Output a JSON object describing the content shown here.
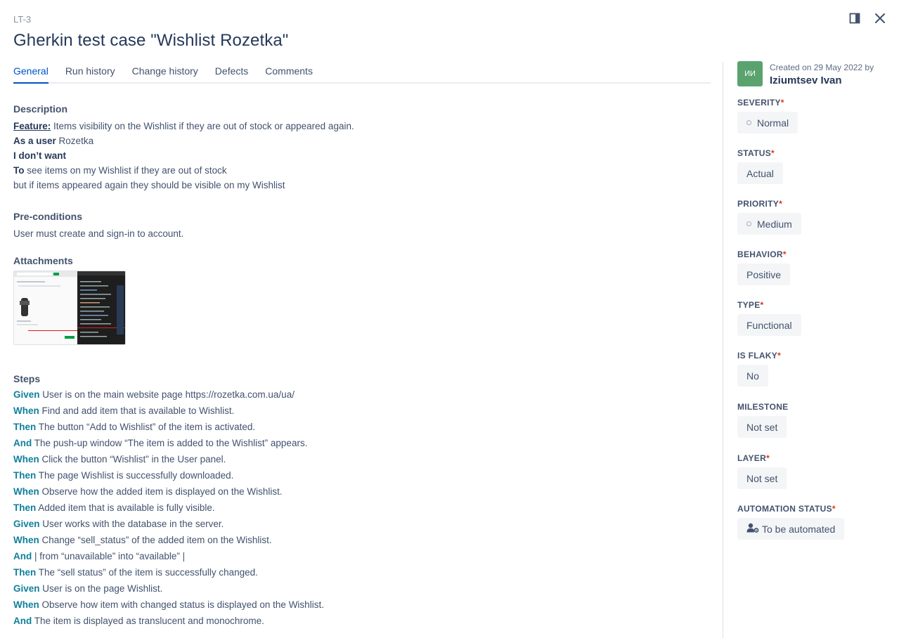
{
  "header": {
    "case_key": "LT-3",
    "title": "Gherkin test case \"Wishlist Rozetka\"",
    "icons": [
      "panel-toggle-icon",
      "close-icon"
    ]
  },
  "tabs": [
    {
      "label": "General",
      "active": true
    },
    {
      "label": "Run history",
      "active": false
    },
    {
      "label": "Change history",
      "active": false
    },
    {
      "label": "Defects",
      "active": false
    },
    {
      "label": "Comments",
      "active": false
    }
  ],
  "description": {
    "label": "Description",
    "feature_keyword": "Feature:",
    "feature_text": " Items visibility on the Wishlist if they are out of stock or appeared again.",
    "as_a_user_keyword": "As a user",
    "as_a_user_text": " Rozetka",
    "i_dont_want": "I don’t want",
    "to_keyword": "To",
    "to_text": " see items on my Wishlist if they are out of stock",
    "last_line": "but if items appeared again they should be visible on my Wishlist"
  },
  "preconditions": {
    "label": "Pre-conditions",
    "text": "User must create and sign-in to account."
  },
  "attachments": {
    "label": "Attachments"
  },
  "steps": {
    "label": "Steps",
    "items": [
      {
        "kw": "Given",
        "text": " User is on the main website page https://rozetka.com.ua/ua/"
      },
      {
        "kw": "When",
        "text": " Find and add item that is available to Wishlist."
      },
      {
        "kw": "Then",
        "text": " The button “Add to Wishlist” of the item is activated."
      },
      {
        "kw": "And",
        "text": " The push-up window “The item is added to the Wishlist” appears."
      },
      {
        "kw": "When",
        "text": " Click the button “Wishlist” in the User panel."
      },
      {
        "kw": "Then",
        "text": " The page Wishlist is successfully downloaded."
      },
      {
        "kw": "When",
        "text": " Observe how the added item is displayed on the Wishlist."
      },
      {
        "kw": "Then",
        "text": " Added item that is available is fully visible."
      },
      {
        "kw": "Given",
        "text": " User works with the database in the server."
      },
      {
        "kw": "When",
        "text": " Change “sell_status” of the added item on the Wishlist."
      },
      {
        "kw": "And",
        "text": " | from “unavailable” into “available” |"
      },
      {
        "kw": "Then",
        "text": " The “sell status” of the item is successfully changed."
      },
      {
        "kw": "Given",
        "text": " User is on the page Wishlist."
      },
      {
        "kw": "When",
        "text": " Observe how item with changed status is displayed on the Wishlist."
      },
      {
        "kw": "And",
        "text": " The item is displayed as translucent and monochrome."
      }
    ]
  },
  "sidebar": {
    "avatar_initials": "ИИ",
    "created_text": "Created on 29 May 2022 by",
    "created_by": "Iziumtsev Ivan",
    "fields": [
      {
        "label": "SEVERITY",
        "required": true,
        "value": "Normal",
        "dot": true
      },
      {
        "label": "STATUS",
        "required": true,
        "value": "Actual",
        "dot": false
      },
      {
        "label": "PRIORITY",
        "required": true,
        "value": "Medium",
        "dot": true
      },
      {
        "label": "BEHAVIOR",
        "required": true,
        "value": "Positive",
        "dot": false
      },
      {
        "label": "TYPE",
        "required": true,
        "value": "Functional",
        "dot": false
      },
      {
        "label": "IS FLAKY",
        "required": true,
        "value": "No",
        "dot": false
      },
      {
        "label": "MILESTONE",
        "required": false,
        "value": "Not set",
        "dot": false
      },
      {
        "label": "LAYER",
        "required": true,
        "value": "Not set",
        "dot": false
      },
      {
        "label": "AUTOMATION STATUS",
        "required": true,
        "value": "To be automated",
        "dot": false,
        "icon": "user-cog-icon"
      }
    ]
  },
  "colors": {
    "accent": "#0052cc",
    "step_keyword": "#0f7f9c",
    "avatar": "#5aa36f",
    "required_mark": "#de350b"
  }
}
